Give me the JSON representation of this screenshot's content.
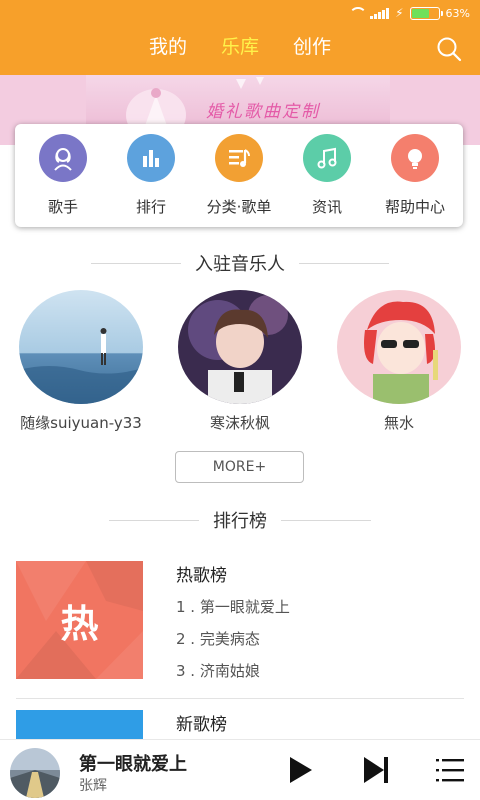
{
  "status": {
    "battery_pct": "63%",
    "battery_level": 0.63
  },
  "tabs": [
    {
      "label": "我的",
      "active": false
    },
    {
      "label": "乐库",
      "active": true
    },
    {
      "label": "创作",
      "active": false
    }
  ],
  "banner": {
    "text": "婚礼歌曲定制"
  },
  "categories": [
    {
      "label": "歌手",
      "icon": "singer-icon",
      "color": "#7A76C7"
    },
    {
      "label": "排行",
      "icon": "ranking-icon",
      "color": "#5DA2DD"
    },
    {
      "label": "分类·歌单",
      "icon": "playlist-icon",
      "color": "#F2A033"
    },
    {
      "label": "资讯",
      "icon": "music-note-icon",
      "color": "#5CCDA8"
    },
    {
      "label": "帮助中心",
      "icon": "help-bulb-icon",
      "color": "#F47F6D"
    }
  ],
  "musicians_section": {
    "title": "入驻音乐人"
  },
  "musicians": [
    {
      "name": "随缘suiyuan-y33"
    },
    {
      "name": "寒沫秋枫"
    },
    {
      "name": "無水"
    }
  ],
  "more_button": {
    "label": "MORE+"
  },
  "charts_section": {
    "title": "排行榜"
  },
  "charts": [
    {
      "title": "热歌榜",
      "cover_text": "热",
      "cover_color": "#F17561",
      "songs": [
        "1 . 第一眼就爱上",
        "2 . 完美病态",
        "3 . 济南姑娘"
      ]
    },
    {
      "title": "新歌榜",
      "cover_text": "",
      "cover_color": "#2F9DE6",
      "songs": []
    }
  ],
  "player": {
    "song": "第一眼就爱上",
    "artist": "张辉"
  },
  "colors": {
    "header": "#F7A02A",
    "active_tab": "#FFF24A"
  }
}
